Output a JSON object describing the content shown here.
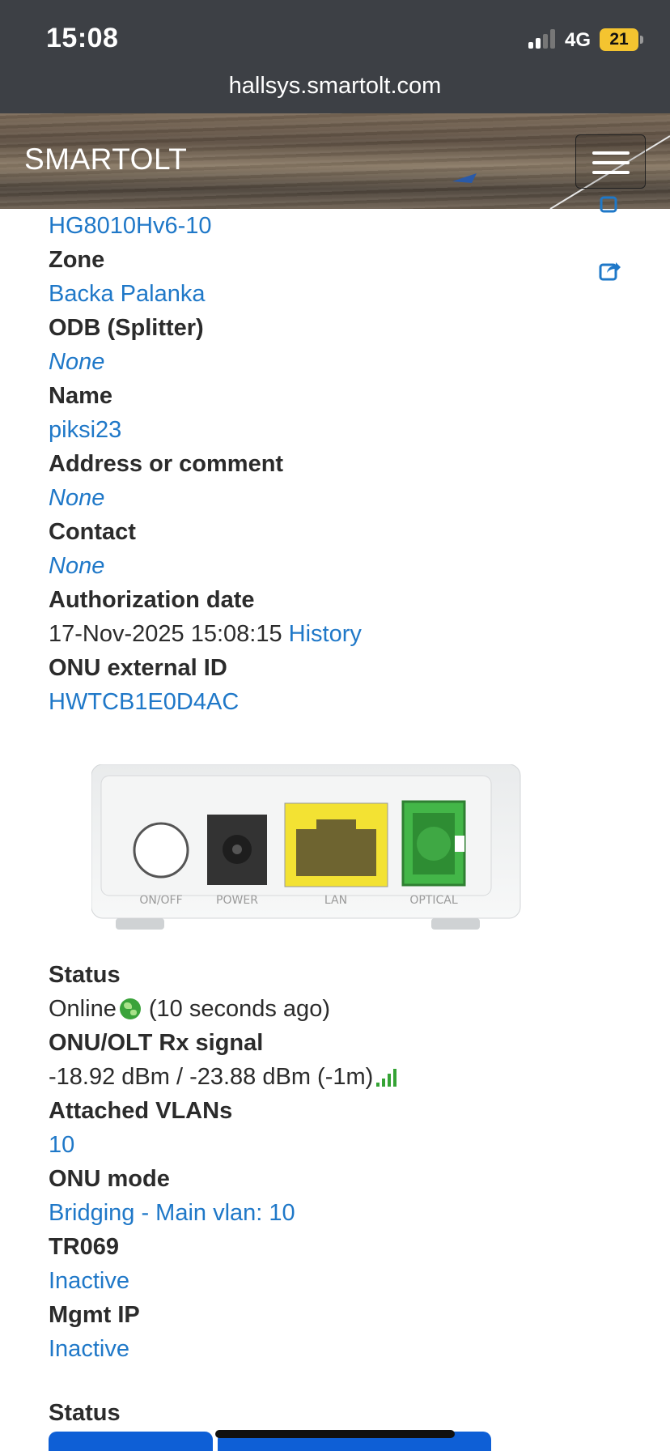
{
  "status_bar": {
    "time": "15:08",
    "network": "4G",
    "battery": "21",
    "signal_bars_active": 2,
    "signal_bars_total": 4
  },
  "browser": {
    "url": "hallsys.smartolt.com"
  },
  "navbar": {
    "brand": "SMARTOLT",
    "menu_icon": "hamburger-icon"
  },
  "details": {
    "onu_type_value": "HG8010Hv6-10",
    "zone_label": "Zone",
    "zone_value": "Backa Palanka",
    "odb_label": "ODB (Splitter)",
    "odb_value": "None",
    "name_label": "Name",
    "name_value": "piksi23",
    "address_label": "Address or comment",
    "address_value": "None",
    "contact_label": "Contact",
    "contact_value": "None",
    "auth_label": "Authorization date",
    "auth_date": "17-Nov-2025 15:08:15",
    "auth_history": "History",
    "ext_id_label": "ONU external ID",
    "ext_id_value": "HWTCB1E0D4AC"
  },
  "device_ports": [
    "ON/OFF",
    "POWER",
    "LAN",
    "OPTICAL"
  ],
  "status": {
    "status_label": "Status",
    "status_online": "Online",
    "status_ago": "(10 seconds ago)",
    "signal_label": "ONU/OLT Rx signal",
    "signal_value": "-18.92 dBm / -23.88 dBm (-1m)",
    "vlans_label": "Attached VLANs",
    "vlans_value": "10",
    "mode_label": "ONU mode",
    "mode_value": "Bridging - Main vlan: 10",
    "tr069_label": "TR069",
    "tr069_value": "Inactive",
    "mgmt_label": "Mgmt IP",
    "mgmt_value": "Inactive"
  },
  "bottom": {
    "section_title": "Status"
  },
  "colors": {
    "link": "#1f78c8",
    "topbar": "#3d4045",
    "button": "#0e5fd6",
    "online": "#3aa33a"
  }
}
